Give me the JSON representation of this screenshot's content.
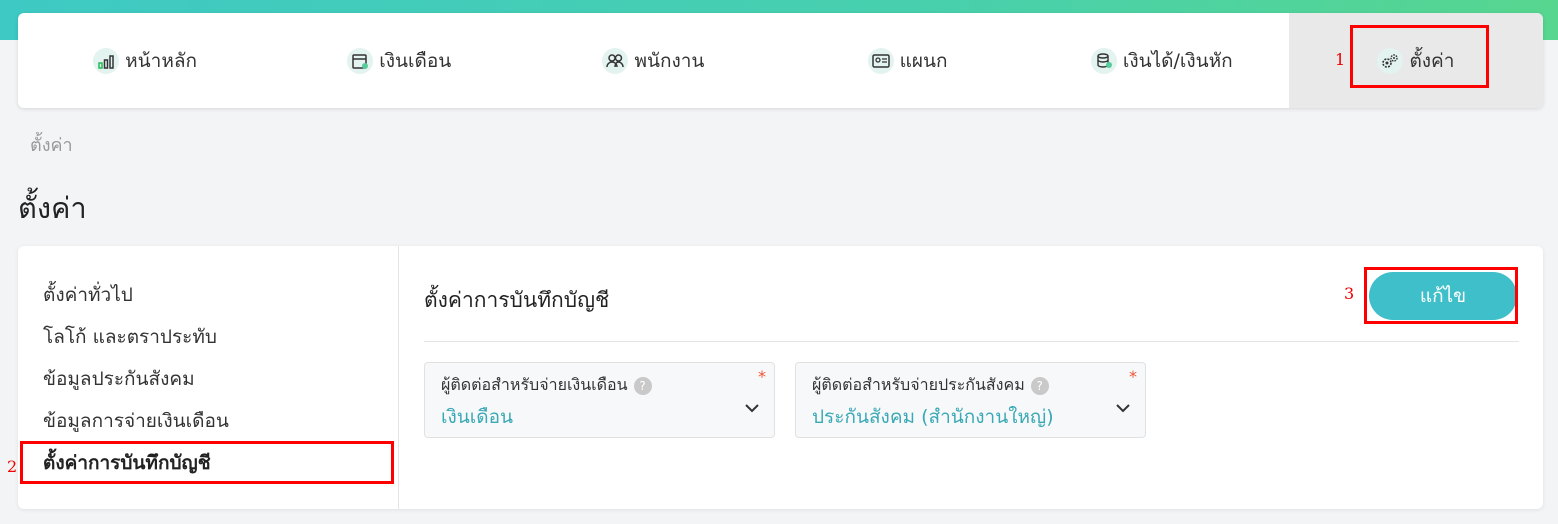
{
  "nav": {
    "items": [
      {
        "label": "หน้าหลัก",
        "icon": "bar-chart-icon"
      },
      {
        "label": "เงินเดือน",
        "icon": "calendar-money-icon"
      },
      {
        "label": "พนักงาน",
        "icon": "users-icon"
      },
      {
        "label": "แผนก",
        "icon": "id-card-icon"
      },
      {
        "label": "เงินได้/เงินหัก",
        "icon": "coins-icon"
      },
      {
        "label": "ตั้งค่า",
        "icon": "gears-icon"
      }
    ]
  },
  "annotations": {
    "n1": "1",
    "n2": "2",
    "n3": "3"
  },
  "breadcrumb": "ตั้งค่า",
  "page_title": "ตั้งค่า",
  "sidebar": {
    "items": [
      {
        "label": "ตั้งค่าทั่วไป"
      },
      {
        "label": "โลโก้ และตราประทับ"
      },
      {
        "label": "ข้อมูลประกันสังคม"
      },
      {
        "label": "ข้อมูลการจ่ายเงินเดือน"
      },
      {
        "label": "ตั้งค่าการบันทึกบัญชี"
      }
    ]
  },
  "main": {
    "title": "ตั้งค่าการบันทึกบัญชี",
    "edit_label": "แก้ไข",
    "fields": [
      {
        "label": "ผู้ติดต่อสำหรับจ่ายเงินเดือน",
        "value": "เงินเดือน",
        "required": "*",
        "help": "?"
      },
      {
        "label": "ผู้ติดต่อสำหรับจ่ายประกันสังคม",
        "value": "ประกันสังคม (สำนักงานใหญ่)",
        "required": "*",
        "help": "?"
      }
    ]
  },
  "colors": {
    "accent": "#3fbfc9",
    "highlight": "#ff0000"
  }
}
